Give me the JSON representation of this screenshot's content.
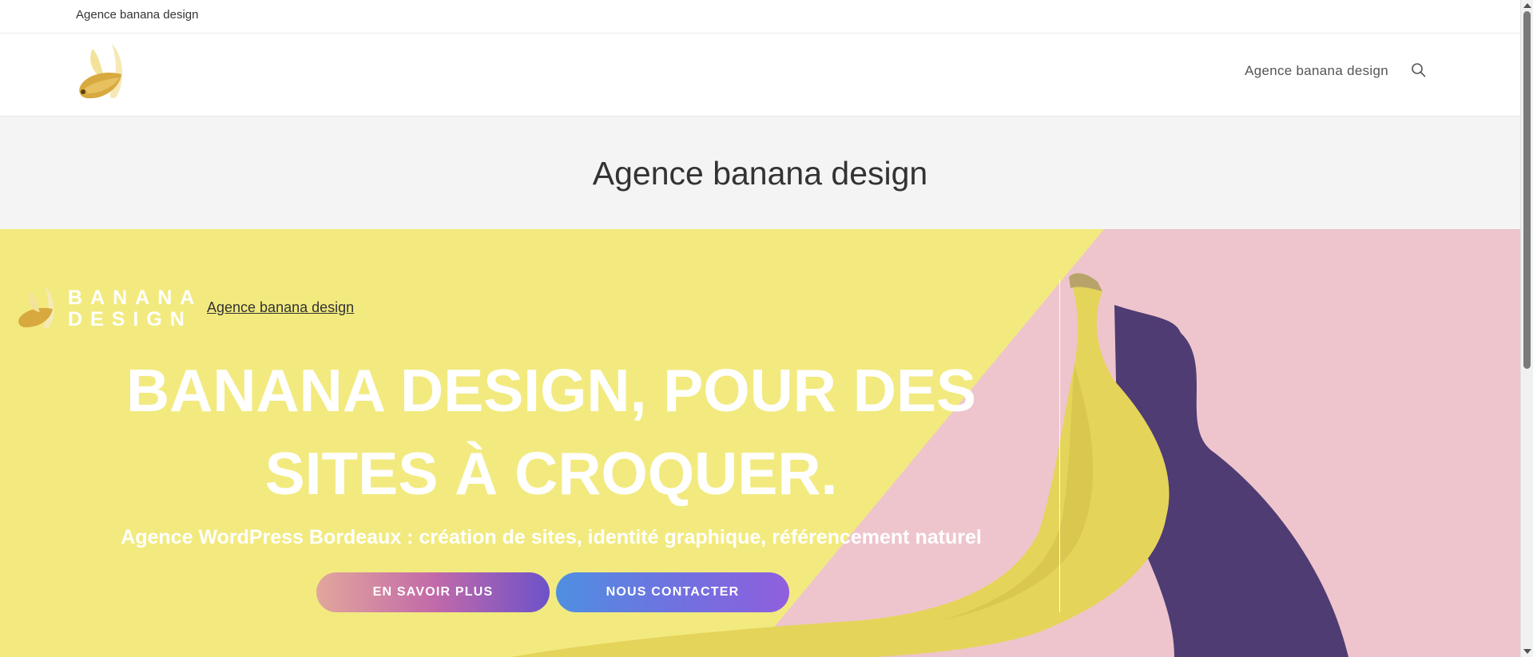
{
  "topbar": {
    "text": "Agence banana design"
  },
  "header": {
    "logo_icon": "banana-icon",
    "nav_link": "Agence banana design",
    "search_icon": "search-icon"
  },
  "title_band": {
    "title": "Agence banana design"
  },
  "hero": {
    "logo_line1": "BANANA",
    "logo_line2": "DESIGN",
    "link": "Agence banana design",
    "heading_line1": "BANANA DESIGN, POUR DES",
    "heading_line2": "SITES À CROQUER.",
    "subheading": "Agence WordPress Bordeaux : création de sites, identité graphique, référencement naturel",
    "button_more": "EN SAVOIR PLUS",
    "button_contact": "NOUS CONTACTER"
  },
  "colors": {
    "hero_yellow": "#f2ea7f",
    "hero_pink": "#eec5cd",
    "shadow_purple": "#4f3c73",
    "banana": "#e5d45a"
  }
}
